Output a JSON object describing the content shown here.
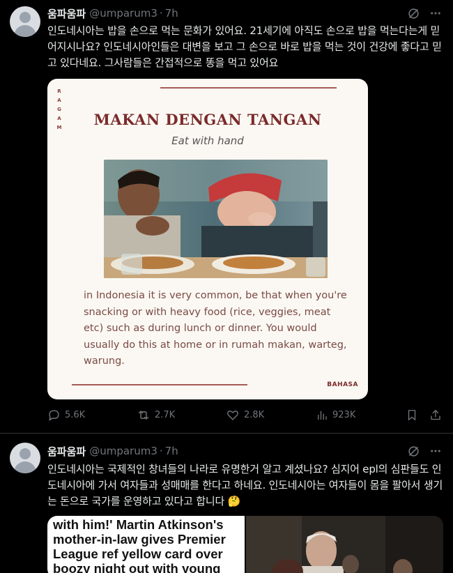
{
  "tweets": [
    {
      "display_name": "움파움파",
      "handle": "@umparum3",
      "separator": "·",
      "time": "7h",
      "text": "인도네시아는 밥을 손으로 먹는 문화가 있어요. 21세기에 아직도 손으로 밥을 먹는다는게 믿어지시나요? 인도네시아인들은 대변을 보고 그 손으로 바로 밥을 먹는 것이 건강에 좋다고 믿고 있다네요. 그사람들은 간접적으로 똥을 먹고 있어요",
      "card": {
        "side_label": "RAGAM",
        "title": "MAKAN DENGAN TANGAN",
        "subtitle": "Eat with hand",
        "body": "in Indonesia it is very common, be that when you're snacking or with heavy food (rice, veggies, meat etc) such as during lunch or dinner. You would usually do this at home or in rumah makan, warteg, warung.",
        "corner_label": "BAHASA"
      },
      "metrics": {
        "replies": "5.6K",
        "reposts": "2.7K",
        "likes": "2.8K",
        "views": "923K"
      }
    },
    {
      "display_name": "움파움파",
      "handle": "@umparum3",
      "separator": "·",
      "time": "7h",
      "text": "인도네시아는 국제적인 창녀들의 나라로 유명한거 알고 계셨나요? 심지어 epl의 심판들도 인도네시아에 가서 여자들과 성매매를 한다고 하네요. 인도네시아는 여자들이 몸을 팔아서 생기는 돈으로 국가를 운영하고 있다고 합니다 🤔",
      "news_headline": "with him!' Martin Atkinson's mother-in-law gives Premier League ref yellow card over boozy night out with young"
    }
  ],
  "icons": {
    "grok": "grok-icon",
    "more": "more-icon",
    "reply": "reply-icon",
    "repost": "repost-icon",
    "like": "like-icon",
    "views": "views-icon",
    "bookmark": "bookmark-icon",
    "share": "share-icon"
  },
  "colors": {
    "background": "#000000",
    "text": "#e7e9ea",
    "muted": "#71767b",
    "divider": "#2f3336",
    "card_accent": "#7a2a2a"
  }
}
